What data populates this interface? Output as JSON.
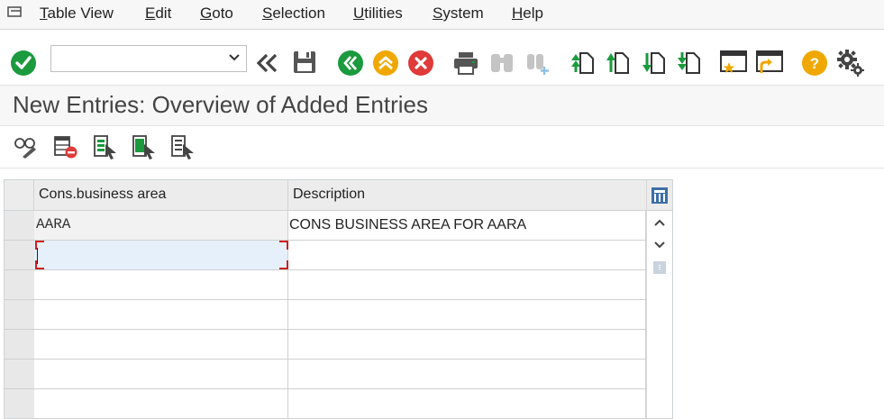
{
  "menu": {
    "items": [
      "Table View",
      "Edit",
      "Goto",
      "Selection",
      "Utilities",
      "System",
      "Help"
    ]
  },
  "toolbar": {
    "command_field_value": ""
  },
  "page": {
    "title": "New Entries: Overview of Added Entries"
  },
  "table": {
    "columns": [
      "Cons.business area",
      "Description"
    ],
    "rows": [
      {
        "area": "AARA",
        "description": "CONS BUSINESS AREA FOR AARA"
      },
      {
        "area": "",
        "description": ""
      },
      {
        "area": "",
        "description": ""
      },
      {
        "area": "",
        "description": ""
      },
      {
        "area": "",
        "description": ""
      },
      {
        "area": "",
        "description": ""
      },
      {
        "area": "",
        "description": ""
      }
    ]
  },
  "colors": {
    "green": "#1b9a3e",
    "orange": "#f0a800",
    "red": "#e03a3a",
    "selected_cell": "#e5f0fa",
    "focus_border": "#cc1f1f"
  }
}
